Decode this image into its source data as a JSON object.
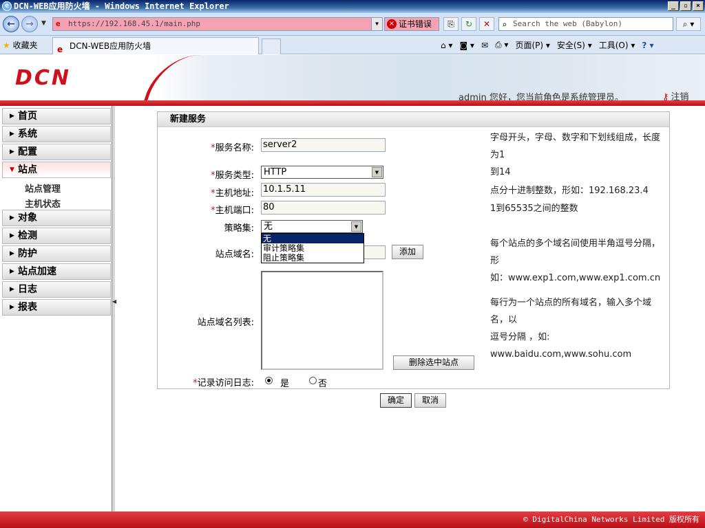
{
  "window": {
    "title": "DCN-WEB应用防火墙 - Windows Internet Explorer",
    "btn_min": "_",
    "btn_max": "▫",
    "btn_close": "×"
  },
  "browser": {
    "address": "https://192.168.45.1/main.php",
    "cert_error": "证书错误",
    "search_placeholder": "Search the web (Babylon)",
    "favorites": "收藏夹",
    "tab_title": "DCN-WEB应用防火墙",
    "cmd_page": "页面(P)",
    "cmd_safety": "安全(S)",
    "cmd_tools": "工具(O)"
  },
  "header": {
    "logo": "DCN",
    "welcome": "admin 您好，您当前角色是系统管理员。",
    "logout": "注销"
  },
  "sidebar": {
    "items": [
      {
        "label": "首页"
      },
      {
        "label": "系统"
      },
      {
        "label": "配置"
      },
      {
        "label": "站点"
      },
      {
        "label": "对象"
      },
      {
        "label": "检测"
      },
      {
        "label": "防护"
      },
      {
        "label": "站点加速"
      },
      {
        "label": "日志"
      },
      {
        "label": "报表"
      }
    ],
    "subitems": [
      {
        "label": "站点管理"
      },
      {
        "label": "主机状态"
      }
    ]
  },
  "form": {
    "title": "新建服务",
    "service_name_label": "服务名称:",
    "service_name_value": "server2",
    "service_type_label": "服务类型:",
    "service_type_value": "HTTP",
    "host_addr_label": "主机地址:",
    "host_addr_value": "10.1.5.11",
    "host_port_label": "主机端口:",
    "host_port_value": "80",
    "policy_label": "策略集:",
    "policy_value": "无",
    "policy_options": [
      "无",
      "审计策略集",
      "阻止策略集"
    ],
    "domain_label": "站点域名:",
    "add_button": "添加",
    "domain_list_label": "站点域名列表:",
    "delete_button": "删除选中站点",
    "log_label": "记录访问日志:",
    "log_yes": "是",
    "log_no": "否",
    "confirm_button": "确定",
    "cancel_button": "取消",
    "hint_name_1": "字母开头，字母、数字和下划线组成，长度为1",
    "hint_name_2": "到14",
    "hint_addr": "点分十进制整数，形如：192.168.23.4",
    "hint_port": "1到65535之间的整数",
    "hint_domain_1": "每个站点的多个域名间使用半角逗号分隔，形",
    "hint_domain_2": "如：www.exp1.com,www.exp1.com.cn",
    "hint_list_1": "每行为一个站点的所有域名，输入多个域名，以",
    "hint_list_2": "逗号分隔 ，如:",
    "hint_list_3": "www.baidu.com,www.sohu.com"
  },
  "footer": {
    "copyright": "© DigitalChina Networks Limited 版权所有"
  },
  "colors": {
    "brand_red": "#d0111b",
    "selection_blue": "#0a246a"
  }
}
